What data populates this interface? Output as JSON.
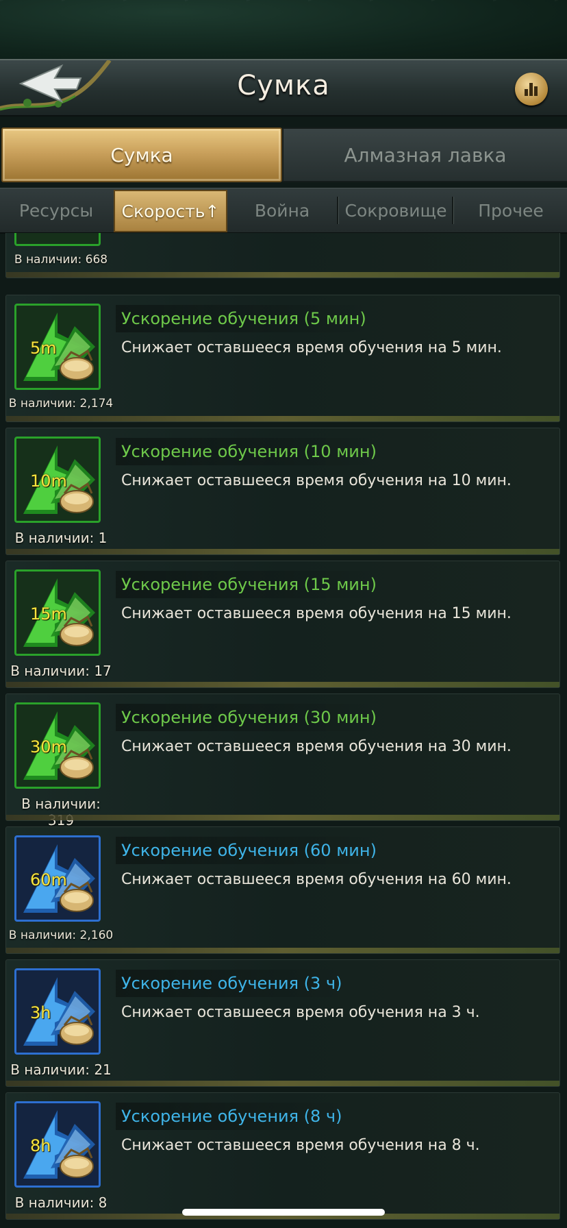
{
  "header": {
    "title": "Сумка"
  },
  "tabs": [
    {
      "label": "Сумка",
      "active": true
    },
    {
      "label": "Алмазная лавка",
      "active": false
    }
  ],
  "subtabs": [
    {
      "label": "Ресурсы",
      "active": false
    },
    {
      "label": "Скорость↑",
      "active": true
    },
    {
      "label": "Война",
      "active": false
    },
    {
      "label": "Сокровище",
      "active": false
    },
    {
      "label": "Прочее",
      "active": false
    }
  ],
  "partial_item": {
    "qty": "В наличии: 668"
  },
  "items": [
    {
      "icon_label": "5m",
      "name": "Ускорение обучения (5 мин)",
      "desc": "Снижает оставшееся время обучения на 5 мин.",
      "qty": "В наличии: 2,174",
      "tier": "green"
    },
    {
      "icon_label": "10m",
      "name": "Ускорение обучения (10 мин)",
      "desc": "Снижает оставшееся время обучения на 10 мин.",
      "qty": "В наличии: 1",
      "tier": "green"
    },
    {
      "icon_label": "15m",
      "name": "Ускорение обучения (15 мин)",
      "desc": "Снижает оставшееся время обучения на 15 мин.",
      "qty": "В наличии: 17",
      "tier": "green"
    },
    {
      "icon_label": "30m",
      "name": "Ускорение обучения (30 мин)",
      "desc": "Снижает оставшееся время обучения на 30 мин.",
      "qty": "В наличии: 319",
      "tier": "green"
    },
    {
      "icon_label": "60m",
      "name": "Ускорение обучения (60 мин)",
      "desc": "Снижает оставшееся время обучения на 60 мин.",
      "qty": "В наличии: 2,160",
      "tier": "blue"
    },
    {
      "icon_label": "3h",
      "name": "Ускорение обучения (3 ч)",
      "desc": "Снижает оставшееся время обучения на 3 ч.",
      "qty": "В наличии: 21",
      "tier": "blue"
    },
    {
      "icon_label": "8h",
      "name": "Ускорение обучения (8 ч)",
      "desc": "Снижает оставшееся время обучения на 8 ч.",
      "qty": "В наличии: 8",
      "tier": "blue"
    }
  ],
  "colors": {
    "green": "#2aa12a",
    "blue": "#2d6fd0",
    "gold": "#caa15c"
  }
}
